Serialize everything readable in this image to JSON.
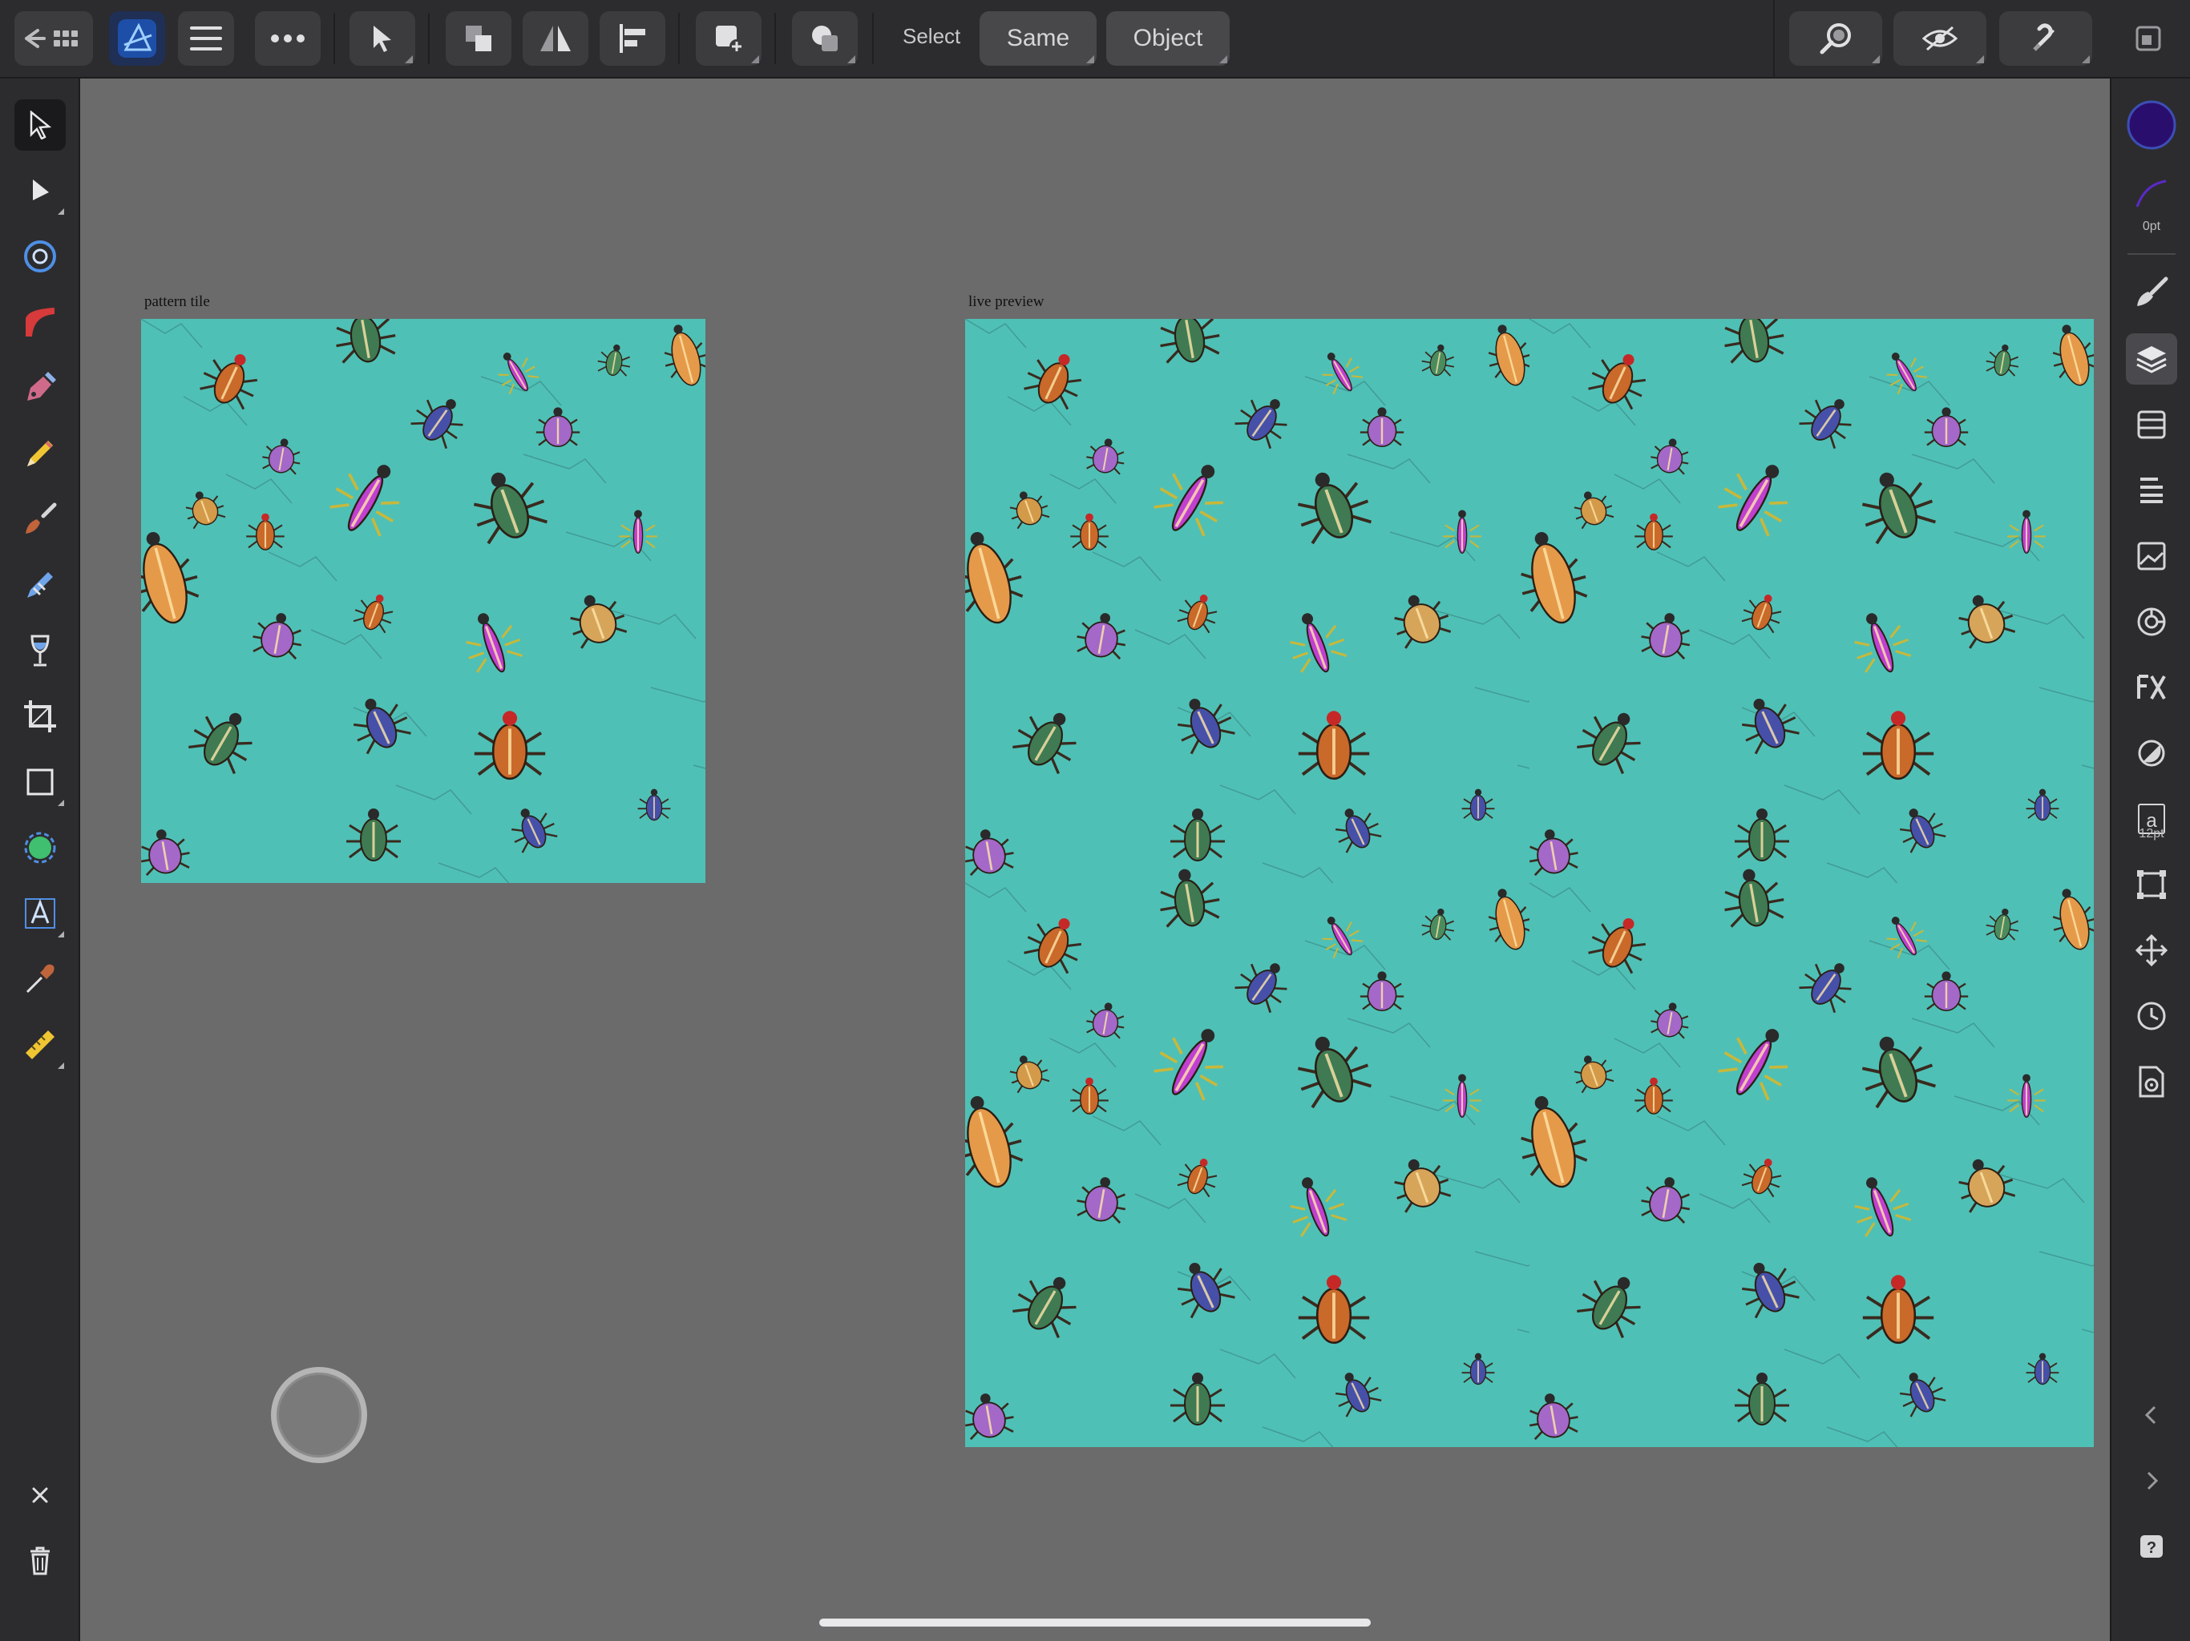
{
  "toolbar": {
    "select_label": "Select",
    "same_button": "Same",
    "object_button": "Object"
  },
  "right_panel": {
    "stroke_width": "0pt",
    "text_size": "12pt",
    "fill_color": "#2a0e6e"
  },
  "canvas": {
    "tile_label": "pattern tile",
    "preview_label": "live preview",
    "pattern_bg": "#4fc0b6"
  }
}
